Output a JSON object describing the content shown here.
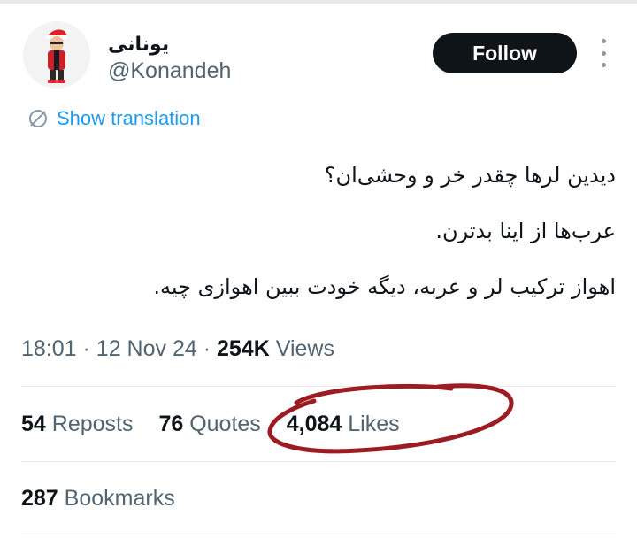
{
  "user": {
    "display_name": "یونانی",
    "handle": "@Konandeh"
  },
  "actions": {
    "follow_label": "Follow",
    "more_icon": "more-vertical-icon"
  },
  "translation": {
    "label": "Show translation",
    "icon": "translate-icon"
  },
  "tweet": {
    "lines": [
      "دیدین لرها چقدر خر و وحشی‌ان؟",
      "عرب‌ها از اینا بدترن.",
      "اهواز ترکیب لر و عربه، دیگه خودت ببین اهوازی چیه."
    ]
  },
  "meta": {
    "time": "18:01",
    "separator": "·",
    "date": "12 Nov 24",
    "views_count": "254K",
    "views_label": "Views"
  },
  "stats": {
    "reposts_count": "54",
    "reposts_label": "Reposts",
    "quotes_count": "76",
    "quotes_label": "Quotes",
    "likes_count": "4,084",
    "likes_label": "Likes",
    "bookmarks_count": "287",
    "bookmarks_label": "Bookmarks"
  },
  "colors": {
    "accent": "#1d9bf0",
    "text_primary": "#0f1419",
    "text_secondary": "#536471",
    "follow_bg": "#0f1419",
    "annotation_ink": "#9b1c23"
  }
}
